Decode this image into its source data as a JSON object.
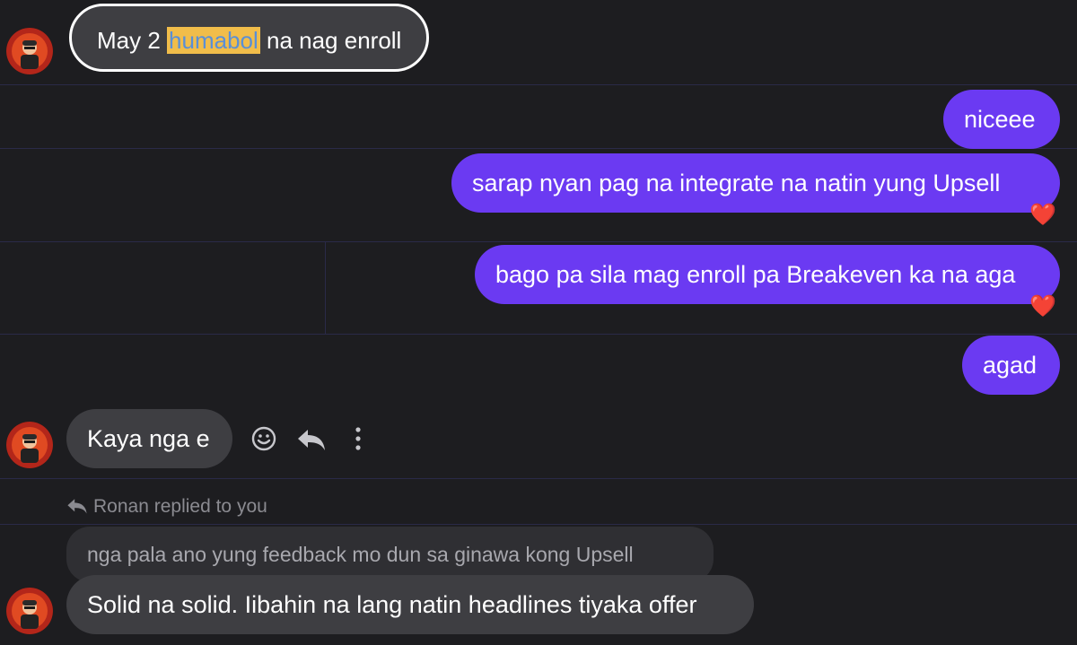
{
  "messages": {
    "first_incoming": {
      "before": "May 2 ",
      "highlight": "humabol",
      "after": " na nag enroll"
    },
    "outgoing": [
      {
        "text": "niceee"
      },
      {
        "text": "sarap nyan pag na integrate na natin yung Upsell",
        "reaction": "❤️"
      },
      {
        "text": "bago pa sila mag enroll pa Breakeven ka na aga",
        "reaction": "❤️"
      },
      {
        "text": "agad"
      }
    ],
    "incoming_2": {
      "text": "Kaya nga e"
    },
    "reply": {
      "label": "Ronan replied to you",
      "quoted": "nga pala ano yung feedback mo dun sa ginawa kong Upsell",
      "text": "Solid na solid. Iibahin na lang natin headlines tiyaka offer"
    }
  },
  "icons": {
    "emoji": "smiley-icon",
    "reply": "reply-arrow-icon",
    "more": "more-vertical-icon"
  },
  "colors": {
    "background": "#1d1d20",
    "incoming_bubble": "#3e3e42",
    "outgoing_bubble": "#6b3af2",
    "highlight": "#f1bd4a"
  }
}
